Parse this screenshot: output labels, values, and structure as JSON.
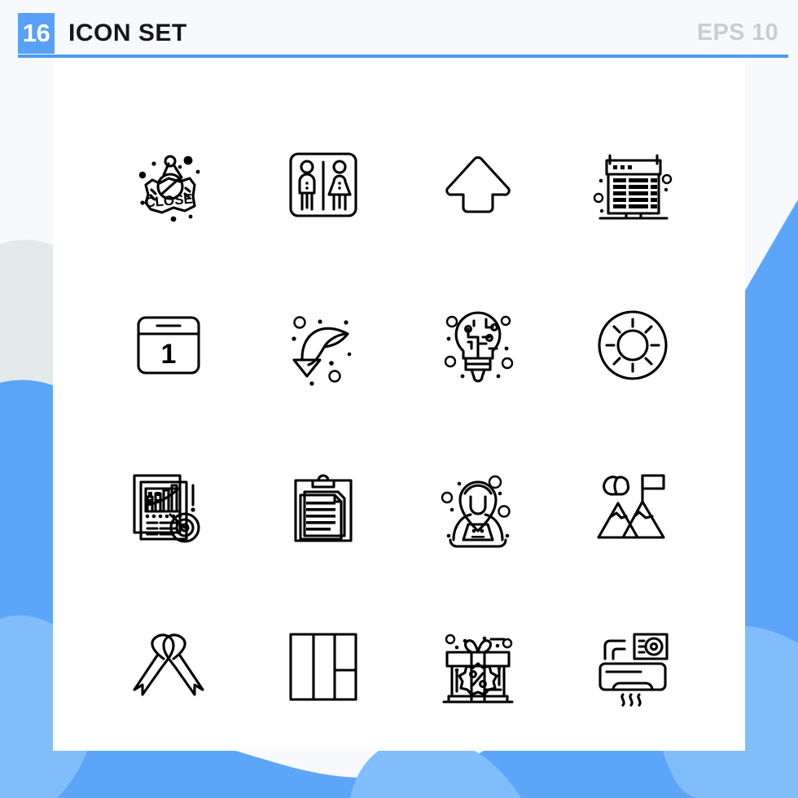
{
  "header": {
    "count_badge": "16",
    "title": "ICON SET",
    "eps_label": "EPS 10",
    "badge_color": "#58a0f8",
    "rule_color": "#4d9bf5",
    "title_color": "#161616",
    "eps_color": "#c9ccd1"
  },
  "canvas": {
    "background_color": "#f7f9fc",
    "card_color": "#ffffff",
    "blob_primary_color": "#5da5f9",
    "blob_secondary_color": "#82bdfb",
    "blob_grey_color": "#e4e9ec",
    "icon_stroke_color": "#000000"
  },
  "grid": {
    "columns": 4,
    "rows": 4,
    "icons": [
      {
        "index": 1,
        "name": "close-sign-icon",
        "label": "CLOSE",
        "inner_text": "CLOSE"
      },
      {
        "index": 2,
        "name": "restroom-sign-icon",
        "label": "Restroom Sign",
        "inner_text": ""
      },
      {
        "index": 3,
        "name": "up-arrow-icon",
        "label": "Up Arrow",
        "inner_text": ""
      },
      {
        "index": 4,
        "name": "newspaper-icon",
        "label": "Newspaper",
        "inner_text": ""
      },
      {
        "index": 5,
        "name": "calendar-day-icon",
        "label": "Calendar Day",
        "inner_text": "1"
      },
      {
        "index": 6,
        "name": "curved-down-arrow-icon",
        "label": "Curved Down Arrow",
        "inner_text": ""
      },
      {
        "index": 7,
        "name": "idea-circuit-bulb-icon",
        "label": "Circuit Light Bulb",
        "inner_text": ""
      },
      {
        "index": 8,
        "name": "lifebuoy-icon",
        "label": "Lifebuoy",
        "inner_text": ""
      },
      {
        "index": 9,
        "name": "business-report-icon",
        "label": "Business Report",
        "inner_text": ""
      },
      {
        "index": 10,
        "name": "clipboard-document-icon",
        "label": "Clipboard Document",
        "inner_text": ""
      },
      {
        "index": 11,
        "name": "hacker-laptop-icon",
        "label": "Hacker With Laptop",
        "inner_text": ""
      },
      {
        "index": 12,
        "name": "mountain-flag-goal-icon",
        "label": "Mountain Flag Goal",
        "inner_text": ""
      },
      {
        "index": 13,
        "name": "awareness-ribbon-icon",
        "label": "Awareness Ribbon",
        "inner_text": ""
      },
      {
        "index": 14,
        "name": "layout-grid-icon",
        "label": "Layout Grid",
        "inner_text": ""
      },
      {
        "index": 15,
        "name": "gift-discount-icon",
        "label": "Gift Discount",
        "inner_text": ""
      },
      {
        "index": 16,
        "name": "air-conditioner-icon",
        "label": "Air Conditioner",
        "inner_text": ""
      }
    ]
  }
}
